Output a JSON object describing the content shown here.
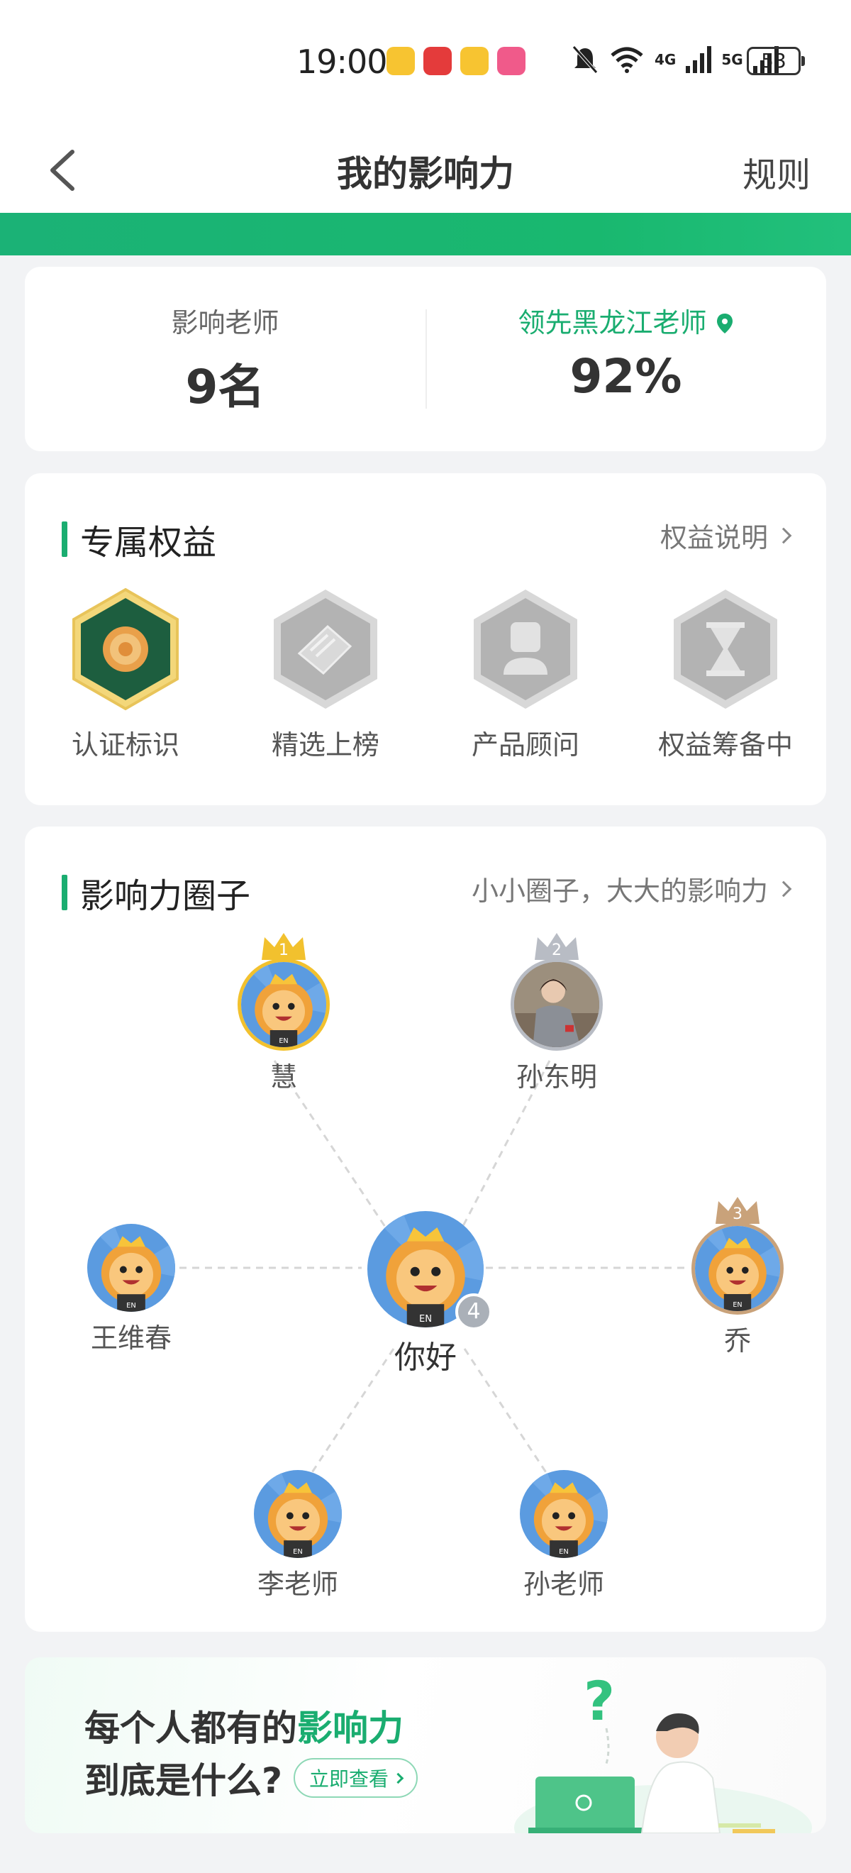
{
  "status_bar": {
    "time": "19:00",
    "battery": "53",
    "net1": "4G",
    "net2": "5G"
  },
  "nav": {
    "title": "我的影响力",
    "rules_label": "规则"
  },
  "stats": {
    "influenced_label": "影响老师",
    "influenced_value": "9名",
    "lead_label": "领先黑龙江老师",
    "lead_value": "92%"
  },
  "rights": {
    "title": "专属权益",
    "link_label": "权益说明",
    "badges": [
      {
        "label": "认证标识",
        "state": "active"
      },
      {
        "label": "精选上榜",
        "state": "locked"
      },
      {
        "label": "产品顾问",
        "state": "locked"
      },
      {
        "label": "权益筹备中",
        "state": "locked"
      }
    ]
  },
  "circle": {
    "title": "影响力圈子",
    "link_label": "小小圈子，大大的影响力",
    "center": {
      "name": "你好",
      "rank": "4"
    },
    "members": [
      {
        "name": "慧",
        "rank": "1"
      },
      {
        "name": "孙东明",
        "rank": "2"
      },
      {
        "name": "乔",
        "rank": "3"
      },
      {
        "name": "王维春"
      },
      {
        "name": "李老师"
      },
      {
        "name": "孙老师"
      }
    ]
  },
  "promo": {
    "line1_prefix": "每个人都有的",
    "line1_highlight": "影响力",
    "line2": "到底是什么?",
    "button_label": "立即查看"
  },
  "colors": {
    "brand_green": "#1aad70",
    "gold": "#f2c12e",
    "silver": "#b8bcc4",
    "bronze": "#c9a27a"
  }
}
